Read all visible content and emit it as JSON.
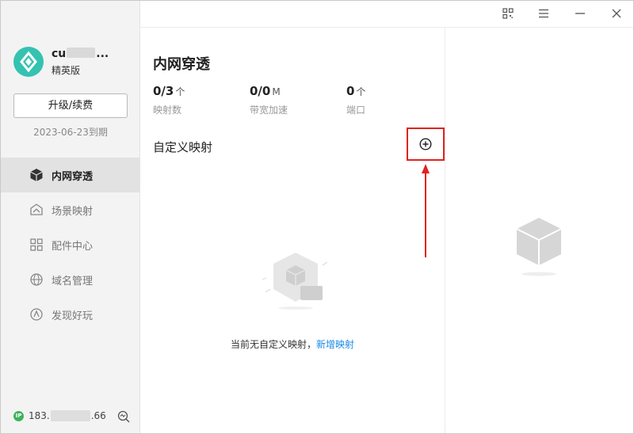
{
  "window": {
    "titlebar_icons": [
      "qr-code-icon",
      "menu-icon",
      "minimize-icon",
      "close-icon"
    ]
  },
  "sidebar": {
    "username_start": "cu",
    "username_end": "...",
    "plan": "精英版",
    "upgrade_label": "升级/续费",
    "expire": "2023-06-23到期",
    "items": [
      {
        "label": "内网穿透",
        "icon": "cube-icon",
        "active": true
      },
      {
        "label": "场景映射",
        "icon": "scene-icon",
        "active": false
      },
      {
        "label": "配件中心",
        "icon": "grid-icon",
        "active": false
      },
      {
        "label": "域名管理",
        "icon": "globe-icon",
        "active": false
      },
      {
        "label": "发现好玩",
        "icon": "compass-icon",
        "active": false
      }
    ],
    "ip_badge": "IP",
    "ip_start": "183.",
    "ip_end": ".66"
  },
  "main": {
    "title": "内网穿透",
    "stats": [
      {
        "value": "0/3",
        "unit": "个",
        "label": "映射数"
      },
      {
        "value": "0/0",
        "unit": "M",
        "label": "带宽加速"
      },
      {
        "value": "0",
        "unit": "个",
        "label": "端口"
      }
    ],
    "section_title": "自定义映射",
    "empty_text": "当前无自定义映射，",
    "empty_link": "新增映射"
  },
  "colors": {
    "accent": "#1a8ae8",
    "highlight": "#e0221f",
    "brand": "#34c2b1",
    "online": "#3db35a"
  }
}
